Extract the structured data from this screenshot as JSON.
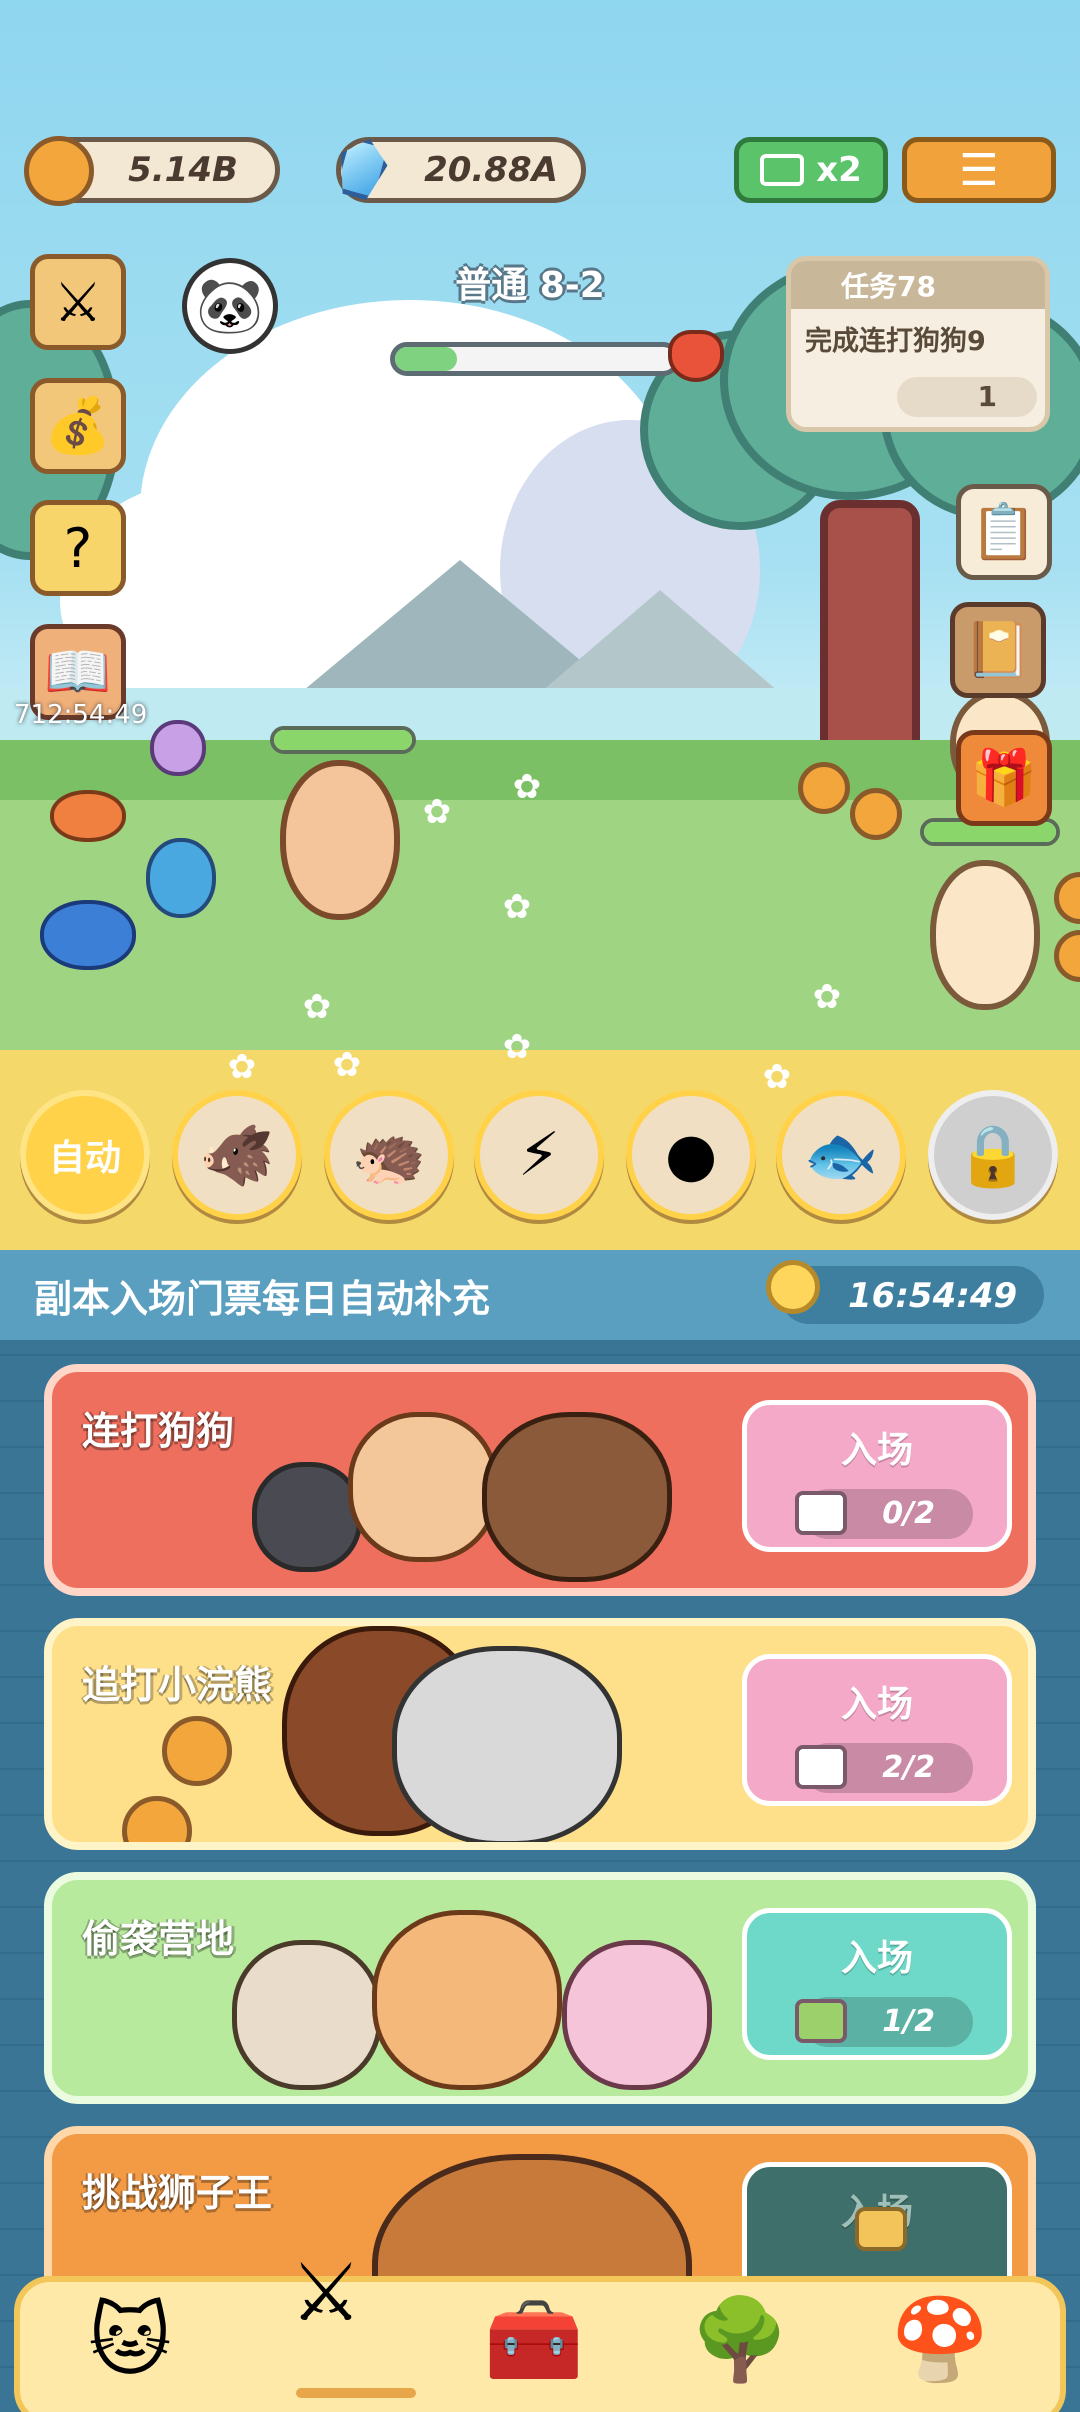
{
  "currency": {
    "coins": "5.14B",
    "gems": "20.88A"
  },
  "top_buttons": {
    "speed_label": "x2"
  },
  "stage": {
    "name": "普通 8-2",
    "progress": 0.22
  },
  "side": {
    "countdown": "712:54:49"
  },
  "quest": {
    "title": "任务78",
    "desc": "完成连打狗狗9",
    "count": "1"
  },
  "skills": {
    "auto_label": "自动",
    "items": [
      "boar-icon",
      "hedgehog-icon",
      "lightning-icon",
      "mole-icon",
      "fish-icon",
      "lock-icon"
    ]
  },
  "banner": {
    "text": "副本入场门票每日自动补充",
    "timer": "16:54:49"
  },
  "dungeons": [
    {
      "title": "连打狗狗",
      "button": "入场",
      "count": "0/2",
      "ticket": "video-icon",
      "bg": "#ee6f5e",
      "border": "#ffd6c8",
      "btn_bg": "#f5a9c9"
    },
    {
      "title": "追打小浣熊",
      "button": "入场",
      "count": "2/2",
      "ticket": "video-icon",
      "bg": "#ffe08a",
      "border": "#fff4c8",
      "btn_bg": "#f5a9c9"
    },
    {
      "title": "偷袭营地",
      "button": "入场",
      "count": "1/2",
      "ticket": "ticket-icon",
      "bg": "#b8ea9e",
      "border": "#eafbe0",
      "btn_bg": "#6fd9c9"
    },
    {
      "title": "挑战狮子王",
      "button": "入场",
      "count": "",
      "ticket": "lock-icon",
      "bg": "#f39a45",
      "border": "#ffd7a8",
      "btn_bg": "#3f6f6a"
    }
  ],
  "nav": {
    "items": [
      "cats-icon",
      "battle-icon",
      "chest-icon",
      "tree-icon",
      "house-icon"
    ],
    "active_index": 1
  }
}
